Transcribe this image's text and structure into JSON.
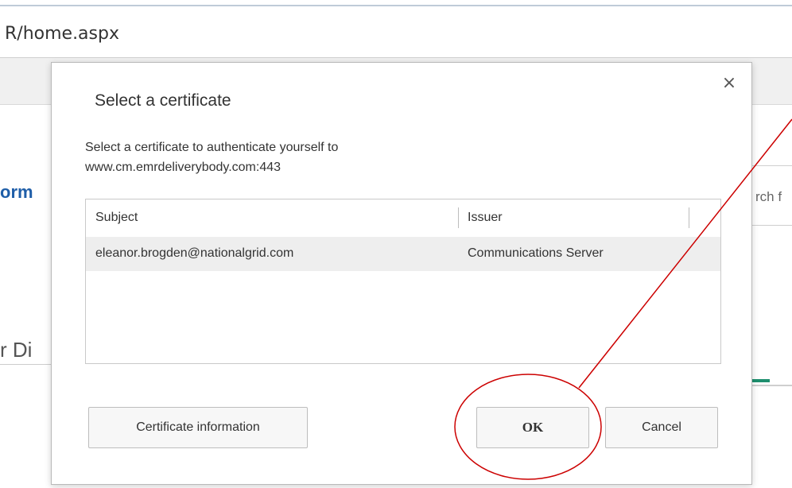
{
  "browser": {
    "address_fragment": "R/home.aspx",
    "left_fragment_1": "orm",
    "left_fragment_2": "r Di",
    "search_fragment": "rch f"
  },
  "dialog": {
    "title": "Select a certificate",
    "close_label": "×",
    "description_line1": "Select a certificate to authenticate yourself to",
    "description_line2": "www.cm.emrdeliverybody.com:443",
    "table": {
      "columns": [
        "Subject",
        "Issuer"
      ],
      "rows": [
        [
          "eleanor.brogden@nationalgrid.com",
          "Communications Server"
        ]
      ]
    },
    "buttons": {
      "certificate_info": "Certificate information",
      "ok": "OK",
      "cancel": "Cancel"
    }
  },
  "annotation": {
    "color": "#cc0000",
    "shape": "ellipse-with-pointer-line",
    "target": "OK button"
  }
}
